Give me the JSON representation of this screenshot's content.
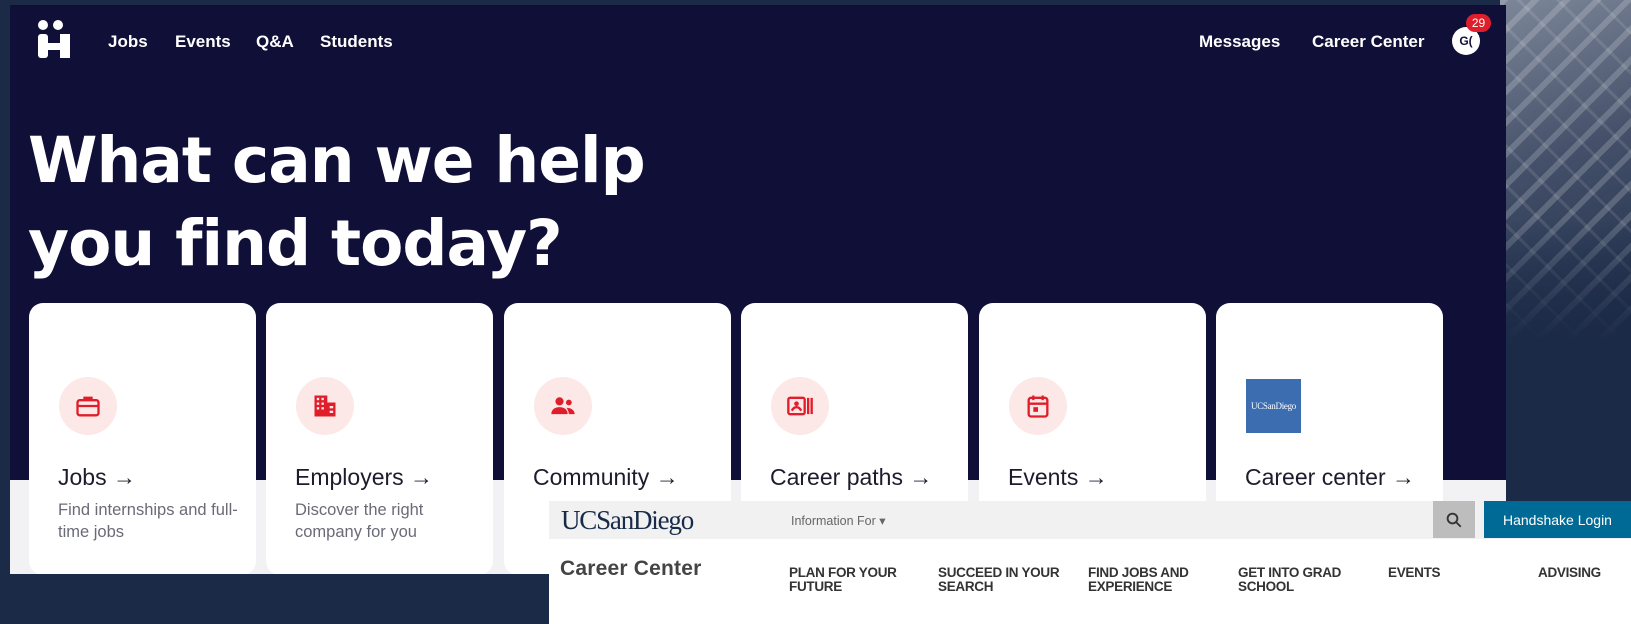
{
  "handshake": {
    "nav": {
      "links": [
        "Jobs",
        "Events",
        "Q&A",
        "Students"
      ],
      "messages": "Messages",
      "career_center": "Career Center",
      "avatar_initials": "G(",
      "notification_count": "29"
    },
    "hero_line1": "What can we help",
    "hero_line2": "you find today?",
    "cards": [
      {
        "title": "Jobs →",
        "desc": "Find internships and full-time jobs",
        "icon": "briefcase-icon"
      },
      {
        "title": "Employers →",
        "desc": "Discover the right company for you",
        "icon": "building-icon"
      },
      {
        "title": "Community →",
        "desc": "",
        "icon": "people-icon"
      },
      {
        "title": "Career paths →",
        "desc": "",
        "icon": "id-card-icon"
      },
      {
        "title": "Events →",
        "desc": "",
        "icon": "calendar-icon"
      },
      {
        "title": "Career center →",
        "desc": "",
        "icon": "ucsd-logo"
      }
    ],
    "ucsd_tile_text": "UCSanDiego",
    "accent_color": "#e01e2b",
    "background_color": "#0f0f38"
  },
  "ucsd": {
    "wordmark": "UCSanDiego",
    "info_for": "Information For ▾",
    "handshake_login": "Handshake Login",
    "career_center_title": "Career Center",
    "menu": [
      "PLAN FOR YOUR FUTURE",
      "SUCCEED IN YOUR SEARCH",
      "FIND JOBS AND EXPERIENCE",
      "GET INTO GRAD SCHOOL",
      "EVENTS",
      "ADVISING"
    ],
    "brand_color": "#182b49",
    "login_color": "#006a96"
  }
}
